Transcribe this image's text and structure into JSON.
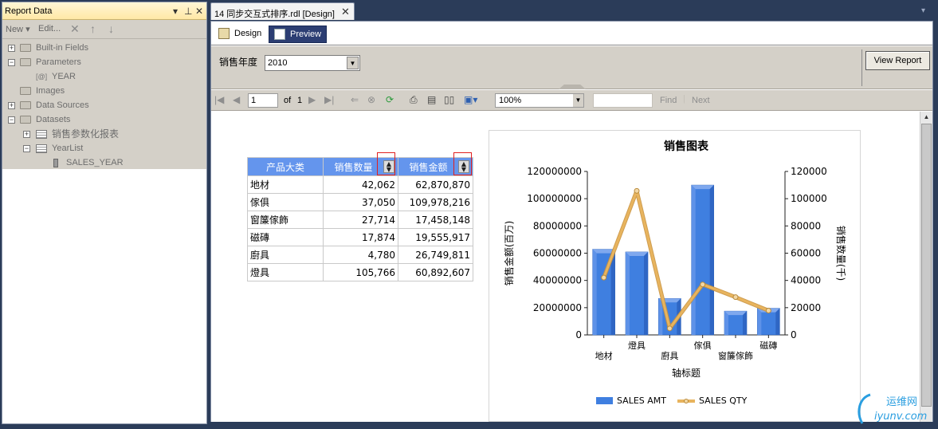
{
  "report_data_panel": {
    "title": "Report Data",
    "toolbar": {
      "new_label": "New",
      "edit_label": "Edit..."
    },
    "tree": {
      "builtin_fields": "Built-in Fields",
      "parameters": "Parameters",
      "param_year": "YEAR",
      "images": "Images",
      "data_sources": "Data Sources",
      "datasets": "Datasets",
      "dataset_sales": "销售参数化报表",
      "dataset_yearlist": "YearList",
      "field_sales_year": "SALES_YEAR"
    }
  },
  "document": {
    "tab_title": "14 同步交互式排序.rdl [Design]",
    "view_tabs": {
      "design": "Design",
      "preview": "Preview"
    },
    "parameter": {
      "label": "销售年度",
      "value": "2010"
    },
    "view_report_label": "View Report",
    "report_toolbar": {
      "page_value": "1",
      "of_label": "of",
      "total_pages": "1",
      "zoom": "100%",
      "find_label": "Find",
      "next_label": "Next"
    }
  },
  "table": {
    "headers": [
      "产品大类",
      "销售数量",
      "销售金额"
    ],
    "rows": [
      [
        "地材",
        "42,062",
        "62,870,870"
      ],
      [
        "傢俱",
        "37,050",
        "109,978,216"
      ],
      [
        "窗簾傢飾",
        "27,714",
        "17,458,148"
      ],
      [
        "磁磚",
        "17,874",
        "19,555,917"
      ],
      [
        "廚具",
        "4,780",
        "26,749,811"
      ],
      [
        "燈具",
        "105,766",
        "60,892,607"
      ]
    ]
  },
  "chart_data": {
    "type": "bar",
    "title": "销售图表",
    "xlabel": "轴标题",
    "ylabel": "销售金额(百万)",
    "y2label": "销售数量(千)",
    "categories": [
      "地材",
      "燈具",
      "廚具",
      "傢俱",
      "窗簾傢飾",
      "磁磚"
    ],
    "ylim": [
      0,
      120000000
    ],
    "y2lim": [
      0,
      120000
    ],
    "yticks": [
      "0",
      "20000000",
      "40000000",
      "60000000",
      "80000000",
      "100000000",
      "120000000"
    ],
    "y2ticks": [
      "0",
      "20000",
      "40000",
      "60000",
      "80000",
      "100000",
      "120000"
    ],
    "series": [
      {
        "name": "SALES AMT",
        "type": "bar",
        "axis": "left",
        "values": [
          62870870,
          60892607,
          26749811,
          109978216,
          17458148,
          19555917
        ]
      },
      {
        "name": "SALES QTY",
        "type": "line",
        "axis": "right",
        "values": [
          42062,
          105766,
          4780,
          37050,
          27714,
          17874
        ]
      }
    ],
    "legend_position": "bottom",
    "colors": {
      "bar": "#3f7fe0",
      "line": "#e8b45e"
    }
  },
  "watermark": {
    "brand": "运维网",
    "url": "iyunv.com"
  }
}
